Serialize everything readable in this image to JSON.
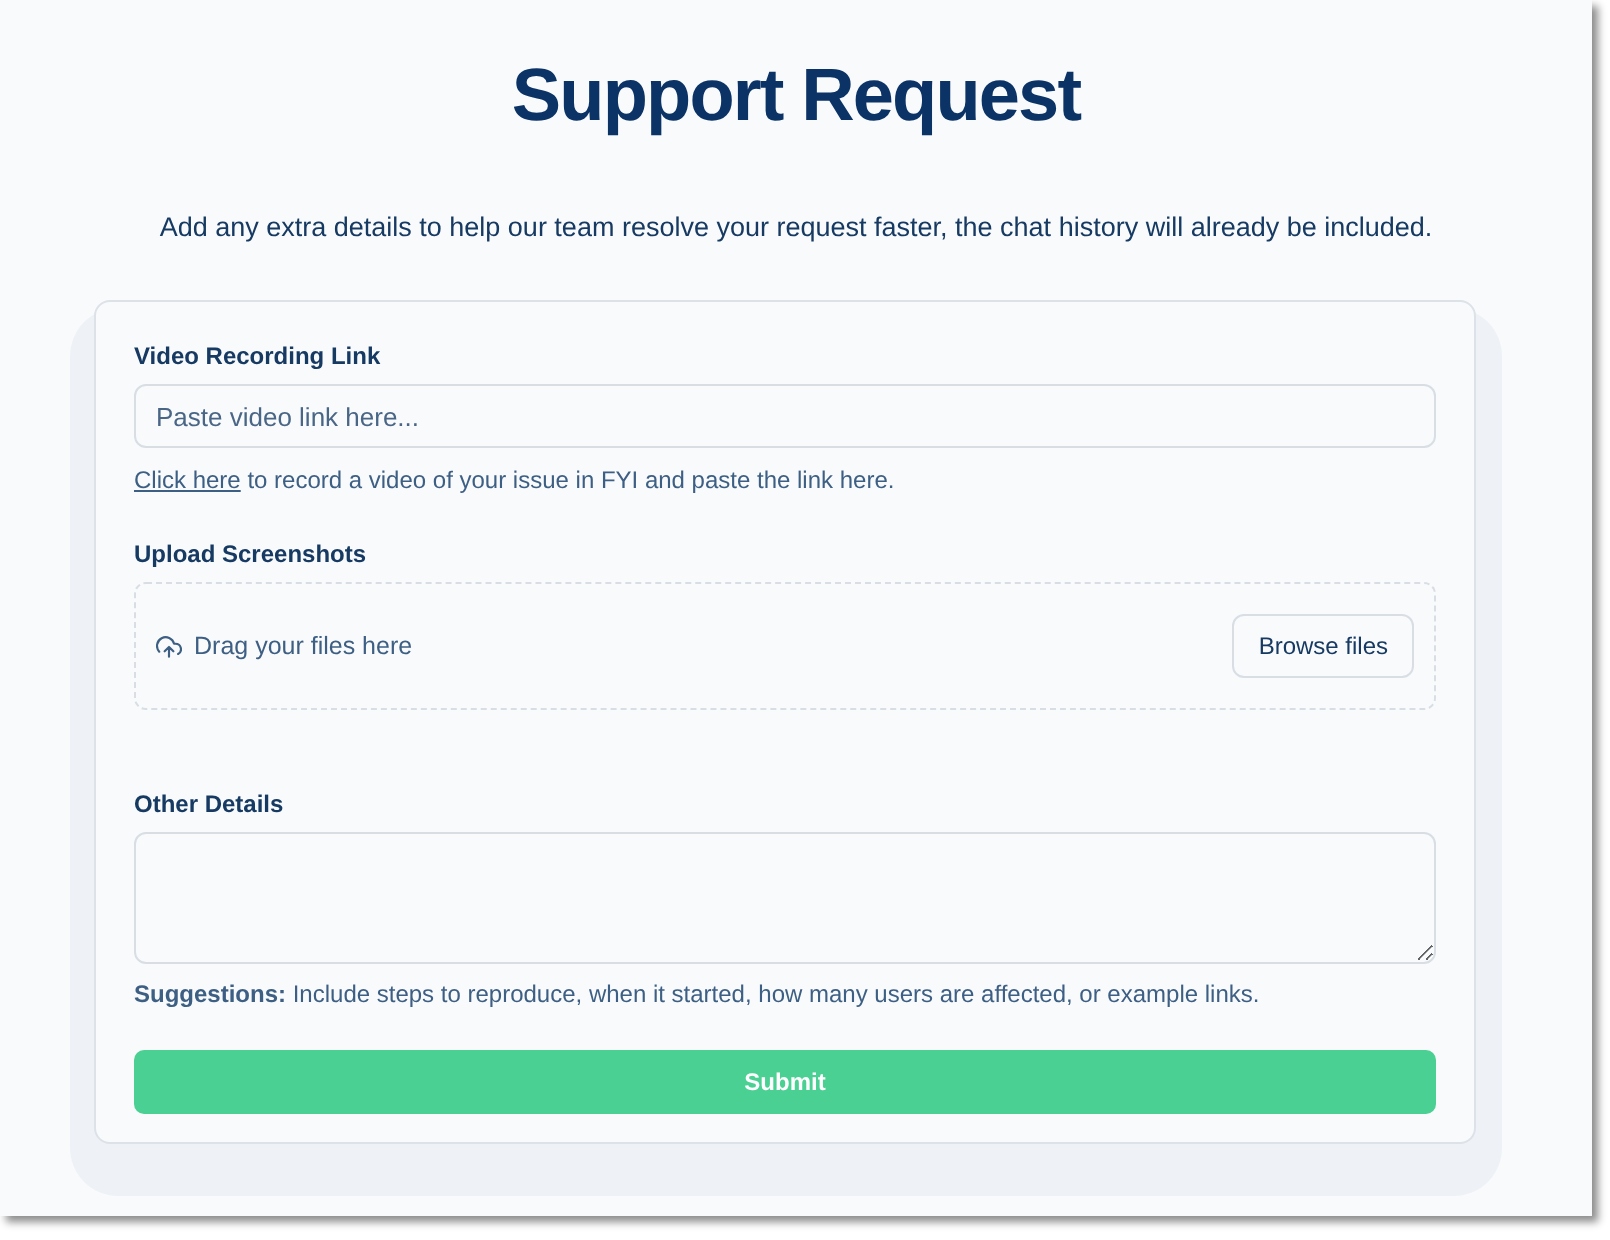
{
  "title": "Support Request",
  "subtitle": "Add any extra details to help our team resolve your request faster, the chat history will already be included.",
  "video_link": {
    "label": "Video Recording Link",
    "placeholder": "Paste video link here...",
    "help_link": "Click here",
    "help_text": " to record a video of your issue in FYI and paste the link here."
  },
  "upload": {
    "label": "Upload Screenshots",
    "drop_text": "Drag your files here",
    "button": "Browse files"
  },
  "other_details": {
    "label": "Other Details",
    "suggestions": "**Suggestions:** Include steps to reproduce, when it started, how many users are affected, or example links."
  },
  "submit": "Submit"
}
